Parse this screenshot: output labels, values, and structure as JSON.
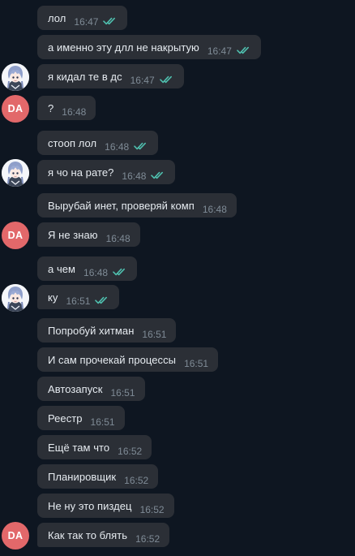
{
  "accent_colors": {
    "background": "#0e1621",
    "bubble": "#2b2f36",
    "read_ticks": "#4fbfae",
    "avatar_da": "#e2686a"
  },
  "avatars": {
    "da_initials": "DA",
    "anime_icon": "anime-character-avatar-icon"
  },
  "messages": [
    {
      "text": "лол",
      "time": "16:47"
    },
    {
      "text": "а именно эту длл не накрытую",
      "time": "16:47"
    },
    {
      "text": "я кидал те в дс",
      "time": "16:47"
    },
    {
      "text": "?",
      "time": "16:48"
    },
    {
      "text": "стооп лол",
      "time": "16:48"
    },
    {
      "text": "я чо на рате?",
      "time": "16:48"
    },
    {
      "text": "Вырубай инет, проверяй комп",
      "time": "16:48"
    },
    {
      "text": "Я не знаю",
      "time": "16:48"
    },
    {
      "text": "а чем",
      "time": "16:48"
    },
    {
      "text": "ку",
      "time": "16:51"
    },
    {
      "text": "Попробуй хитман",
      "time": "16:51"
    },
    {
      "text": "И сам прочекай процессы",
      "time": "16:51"
    },
    {
      "text": "Автозапуск",
      "time": "16:51"
    },
    {
      "text": "Реестр",
      "time": "16:51"
    },
    {
      "text": "Ещё там что",
      "time": "16:52"
    },
    {
      "text": "Планировщик",
      "time": "16:52"
    },
    {
      "text": "Не ну это пиздец",
      "time": "16:52"
    },
    {
      "text": "Как так то блять",
      "time": "16:52"
    }
  ]
}
